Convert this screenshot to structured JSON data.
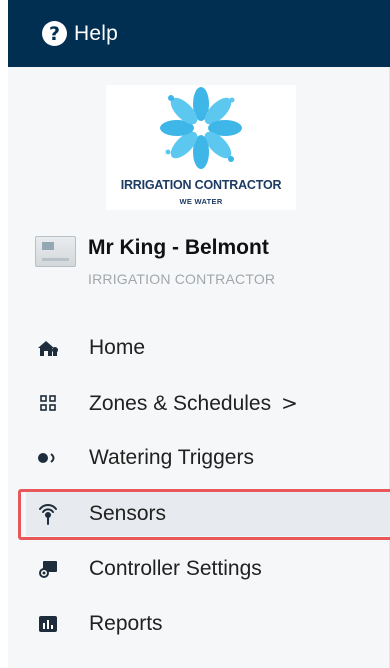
{
  "help": {
    "label": "Help",
    "icon": "question-circle-icon"
  },
  "logo": {
    "title": "IRRIGATION CONTRACTOR",
    "subtitle": "WE WATER"
  },
  "controller": {
    "name": "Mr King - Belmont",
    "organization": "IRRIGATION CONTRACTOR"
  },
  "nav": {
    "items": [
      {
        "label": "Home",
        "icon": "home-icon"
      },
      {
        "label": "Zones & Schedules",
        "icon": "zones-grid-icon",
        "chevron": ">"
      },
      {
        "label": "Watering Triggers",
        "icon": "watering-triggers-icon"
      },
      {
        "label": "Sensors",
        "icon": "sensor-antenna-icon",
        "active": true
      },
      {
        "label": "Controller Settings",
        "icon": "controller-settings-icon"
      },
      {
        "label": "Reports",
        "icon": "reports-chart-icon"
      }
    ]
  },
  "colors": {
    "header_bg": "#012f52",
    "highlight_border": "#e8585a",
    "logo_blue": "#1d3b63",
    "logo_water": "#3fb6e8"
  }
}
